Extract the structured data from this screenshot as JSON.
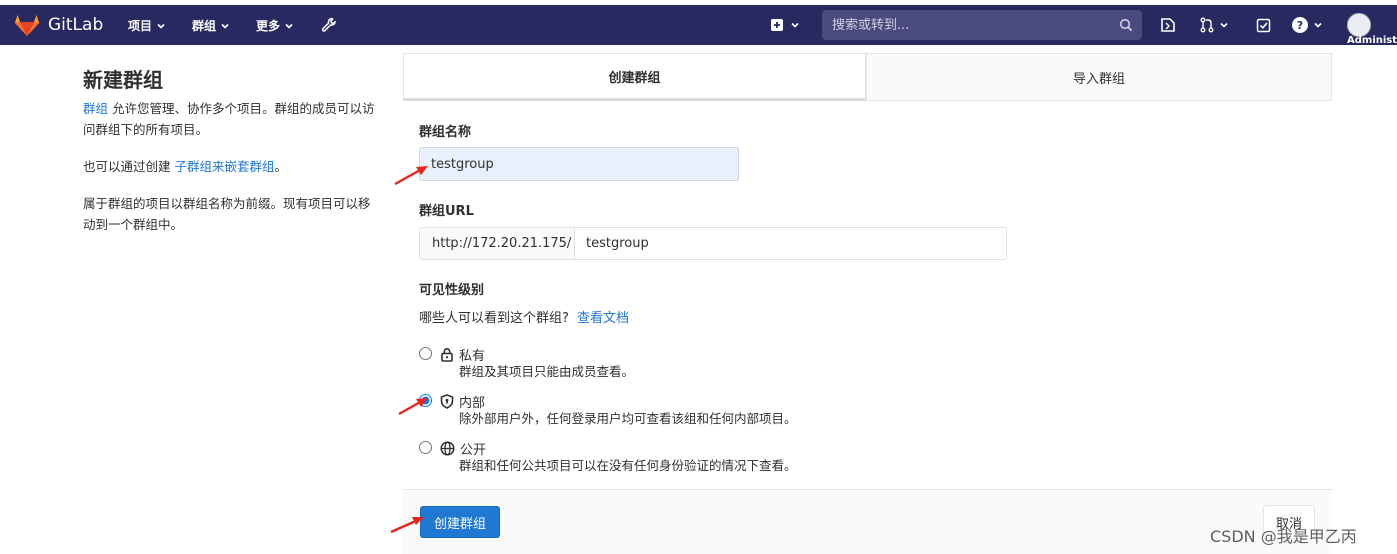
{
  "navbar": {
    "brand": "GitLab",
    "menus": [
      "项目",
      "群组",
      "更多"
    ],
    "search_placeholder": "搜索或转到...",
    "user_label": "Administ",
    "colors": {
      "background": "#292961",
      "search_bg": "#4a4a7e"
    }
  },
  "sidebar": {
    "title": "新建群组",
    "p1_link": "群组",
    "p1_text": " 允许您管理、协作多个项目。群组的成员可以访问群组下的所有项目。",
    "p2_text": "也可以通过创建 ",
    "p2_link": "子群组来嵌套群组",
    "p2_end": "。",
    "p3_text": "属于群组的项目以群组名称为前缀。现有项目可以移动到一个群组中。"
  },
  "tabs": {
    "create": "创建群组",
    "import": "导入群组"
  },
  "form": {
    "name_label": "群组名称",
    "name_value": "testgroup",
    "url_label": "群组URL",
    "url_prefix": "http://172.20.21.175/",
    "url_value": "testgroup",
    "visibility_label": "可见性级别",
    "visibility_question": "哪些人可以看到这个群组?",
    "docs_link": "查看文档",
    "options": [
      {
        "title": "私有",
        "desc": "群组及其项目只能由成员查看。",
        "icon": "lock-icon",
        "checked": false
      },
      {
        "title": "内部",
        "desc": "除外部用户外，任何登录用户均可查看该组和任何内部项目。",
        "icon": "shield-icon",
        "checked": true
      },
      {
        "title": "公开",
        "desc": "群组和任何公共项目可以在没有任何身份验证的情况下查看。",
        "icon": "globe-icon",
        "checked": false
      }
    ],
    "submit": "创建群组",
    "cancel": "取消"
  },
  "watermark": "CSDN @我是甲乙丙",
  "accent_colors": {
    "primary": "#1f78d1",
    "annotation_arrow": "#e8251c"
  }
}
